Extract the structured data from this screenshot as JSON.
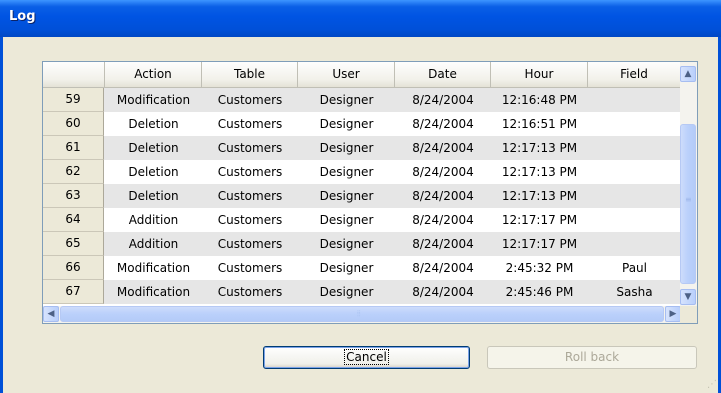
{
  "window": {
    "title": "Log"
  },
  "grid": {
    "columns": [
      "Action",
      "Table",
      "User",
      "Date",
      "Hour",
      "Field"
    ],
    "rows": [
      {
        "num": "59",
        "action": "Modification",
        "table": "Customers",
        "user": "Designer",
        "date": "8/24/2004",
        "hour": "12:16:48 PM",
        "field": ""
      },
      {
        "num": "60",
        "action": "Deletion",
        "table": "Customers",
        "user": "Designer",
        "date": "8/24/2004",
        "hour": "12:16:51 PM",
        "field": ""
      },
      {
        "num": "61",
        "action": "Deletion",
        "table": "Customers",
        "user": "Designer",
        "date": "8/24/2004",
        "hour": "12:17:13 PM",
        "field": ""
      },
      {
        "num": "62",
        "action": "Deletion",
        "table": "Customers",
        "user": "Designer",
        "date": "8/24/2004",
        "hour": "12:17:13 PM",
        "field": ""
      },
      {
        "num": "63",
        "action": "Deletion",
        "table": "Customers",
        "user": "Designer",
        "date": "8/24/2004",
        "hour": "12:17:13 PM",
        "field": ""
      },
      {
        "num": "64",
        "action": "Addition",
        "table": "Customers",
        "user": "Designer",
        "date": "8/24/2004",
        "hour": "12:17:17 PM",
        "field": ""
      },
      {
        "num": "65",
        "action": "Addition",
        "table": "Customers",
        "user": "Designer",
        "date": "8/24/2004",
        "hour": "12:17:17 PM",
        "field": ""
      },
      {
        "num": "66",
        "action": "Modification",
        "table": "Customers",
        "user": "Designer",
        "date": "8/24/2004",
        "hour": "2:45:32 PM",
        "field": "Paul"
      },
      {
        "num": "67",
        "action": "Modification",
        "table": "Customers",
        "user": "Designer",
        "date": "8/24/2004",
        "hour": "2:45:46 PM",
        "field": "Sasha"
      }
    ]
  },
  "icons": {
    "scroll_up": "scroll-up-arrow-icon",
    "scroll_down": "scroll-down-arrow-icon",
    "scroll_left": "scroll-left-arrow-icon",
    "scroll_right": "scroll-right-arrow-icon"
  },
  "buttons": {
    "cancel": "Cancel",
    "rollback": "Roll back"
  },
  "colors": {
    "titlebar": "#0054e3",
    "alt_row": "#e6e6e6",
    "dialog_bg": "#ece9d8"
  }
}
